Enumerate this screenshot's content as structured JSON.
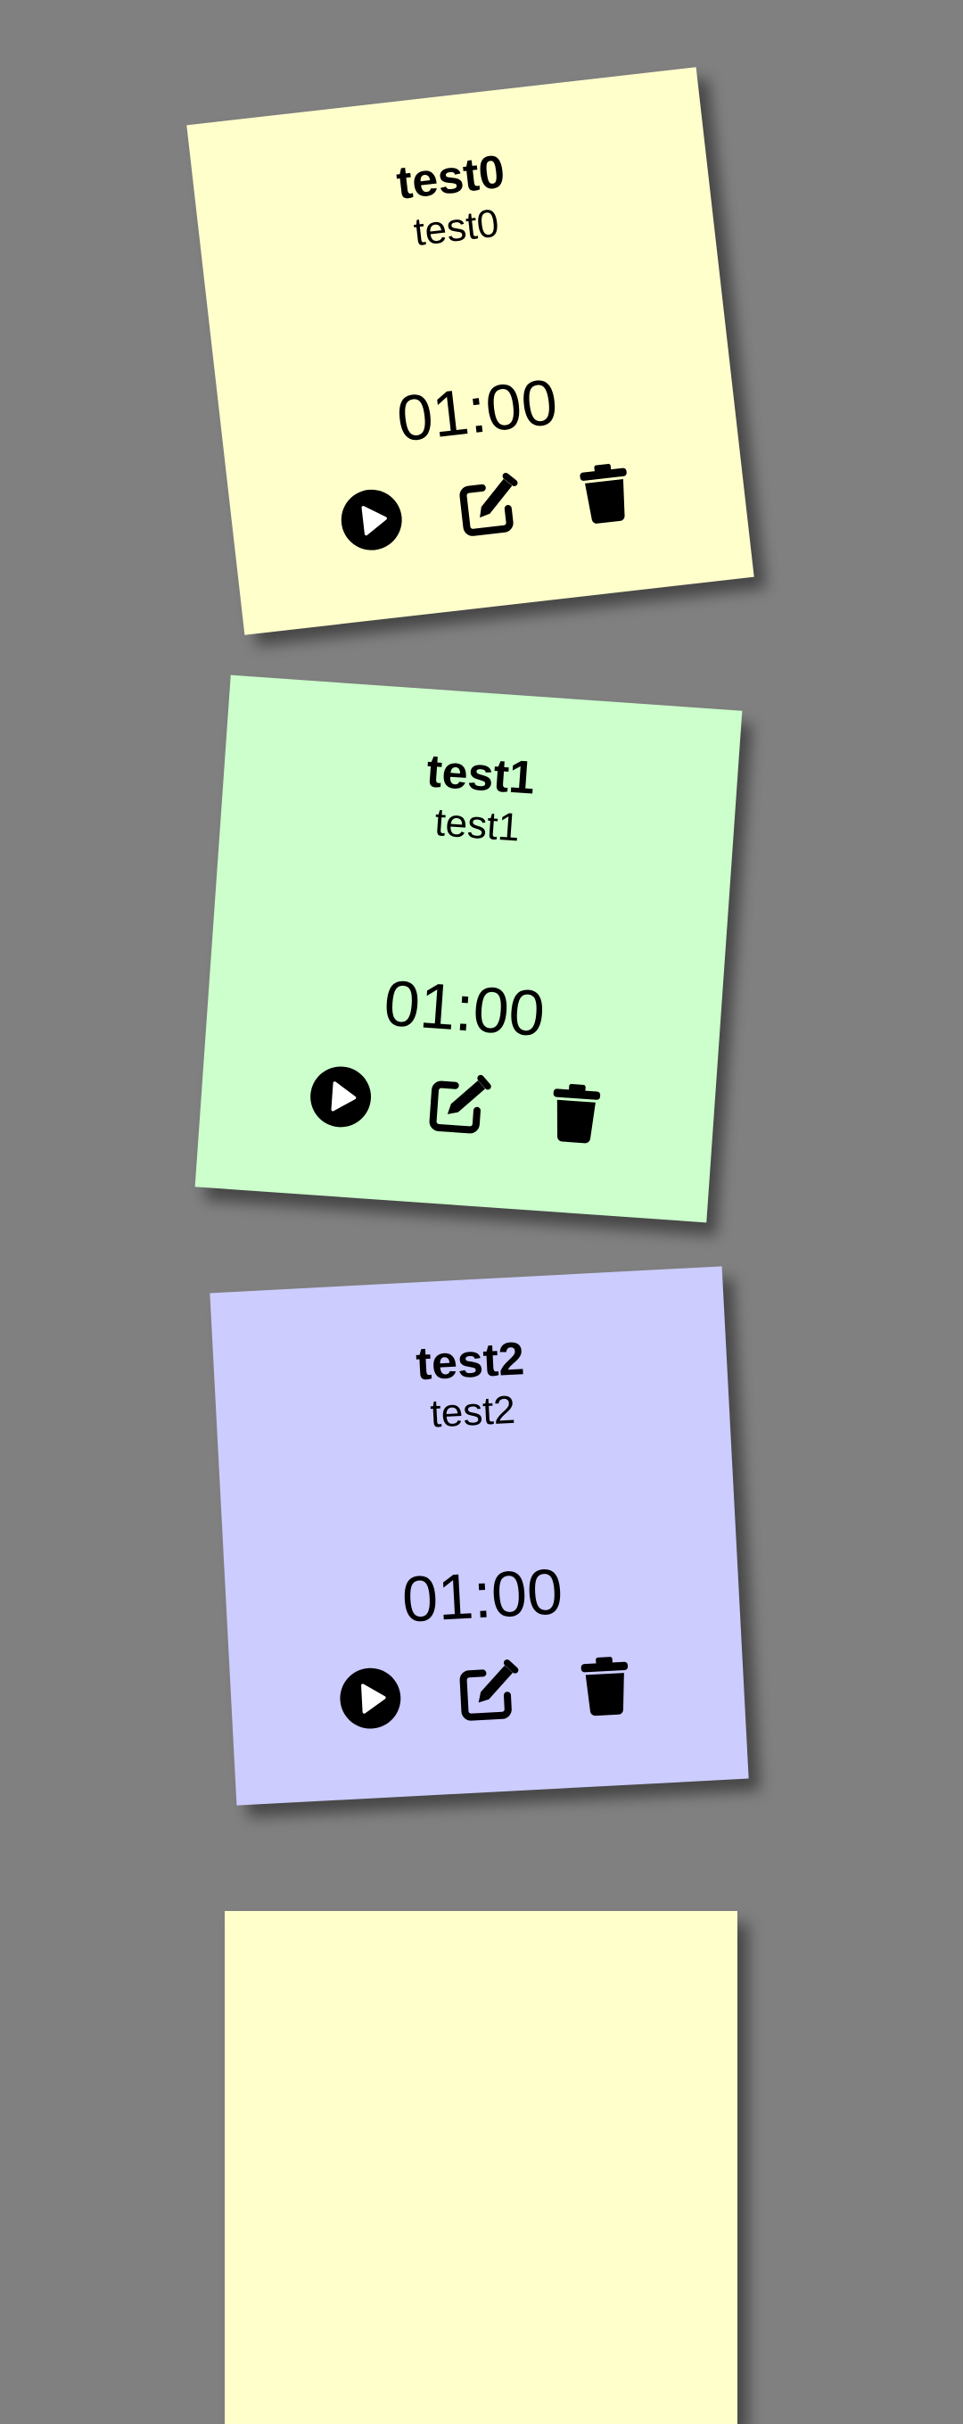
{
  "background_color": "#808080",
  "notes": [
    {
      "title": "test0",
      "subtitle": "test0",
      "time": "01:00",
      "color": "#ffffcc",
      "icons": [
        "play-icon",
        "edit-icon",
        "trash-icon"
      ]
    },
    {
      "title": "test1",
      "subtitle": "test1",
      "time": "01:00",
      "color": "#ccffcc",
      "icons": [
        "play-icon",
        "edit-icon",
        "trash-icon"
      ]
    },
    {
      "title": "test2",
      "subtitle": "test2",
      "time": "01:00",
      "color": "#ccccff",
      "icons": [
        "play-icon",
        "edit-icon",
        "trash-icon"
      ]
    },
    {
      "title": "",
      "subtitle": "",
      "time": "",
      "color": "#ffffcc",
      "icons": []
    }
  ]
}
